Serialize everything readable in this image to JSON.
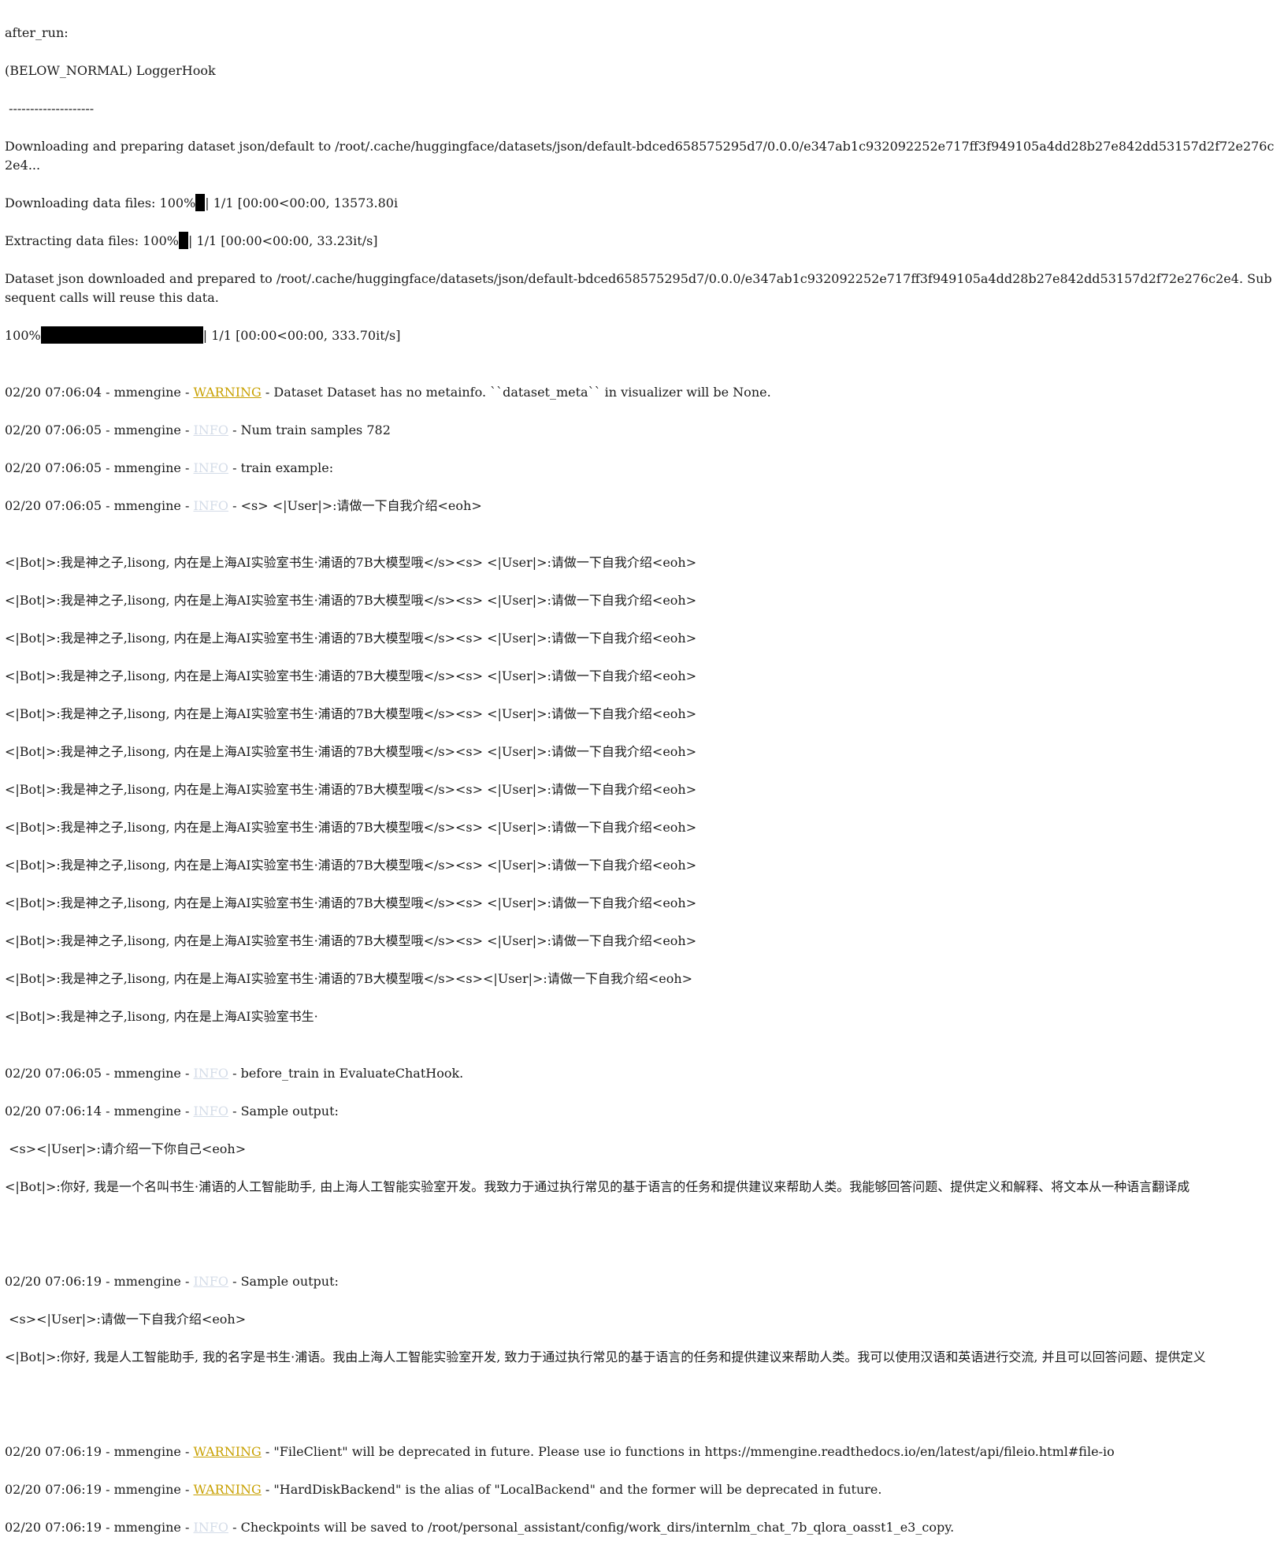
{
  "colors": {
    "warning": "#c8a000",
    "info": "#d4dce8",
    "text": "#1a1a1a",
    "background": "#ffffff"
  },
  "progress": {
    "download_files": 100,
    "extract_files": 100,
    "map_dataset": 100
  },
  "header": {
    "hook_stage": "after_run:",
    "hook_entry": "(BELOW_NORMAL) LoggerHook",
    "separator": " --------------------"
  },
  "dataset": {
    "downloading": "Downloading and preparing dataset json/default to /root/.cache/huggingface/datasets/json/default-bdced658575295d7/0.0.0/e347ab1c932092252e717ff3f949105a4dd28b27e842dd53157d2f72e276c2e4...",
    "download_prefix": "Downloading data files: 100%",
    "download_suffix": "| 1/1 [00:00<00:00, 13573.80i",
    "extract_prefix": "Extracting data files: 100%",
    "extract_suffix": "| 1/1 [00:00<00:00, 33.23it/s]",
    "prepared": "Dataset json downloaded and prepared to /root/.cache/huggingface/datasets/json/default-bdced658575295d7/0.0.0/e347ab1c932092252e717ff3f949105a4dd28b27e842dd53157d2f72e276c2e4. Subsequent calls will reuse this data.",
    "map_prefix": "100%",
    "map_suffix": "| 1/1 [00:00<00:00, 333.70it/s]"
  },
  "log": {
    "l1": {
      "ts": "02/20 07:06:04 - mmengine - ",
      "level": "WARNING",
      "msg": " - Dataset Dataset has no metainfo. ``dataset_meta`` in visualizer will be None."
    },
    "l2": {
      "ts": "02/20 07:06:05 - mmengine - ",
      "level": "INFO",
      "msg": " - Num train samples 782"
    },
    "l3": {
      "ts": "02/20 07:06:05 - mmengine - ",
      "level": "INFO",
      "msg": " - train example:"
    },
    "l4": {
      "ts": "02/20 07:06:05 - mmengine - ",
      "level": "INFO",
      "msg": " - <s> <|User|>:请做一下自我介绍<eoh>"
    },
    "l5": {
      "ts": "02/20 07:06:05 - mmengine - ",
      "level": "INFO",
      "msg": " - before_train in EvaluateChatHook."
    },
    "l6": {
      "ts": "02/20 07:06:14 - mmengine - ",
      "level": "INFO",
      "msg": " - Sample output:"
    },
    "l7": {
      "ts": "02/20 07:06:19 - mmengine - ",
      "level": "INFO",
      "msg": " - Sample output:"
    },
    "l8": {
      "ts": "02/20 07:06:19 - mmengine - ",
      "level": "WARNING",
      "msg": " - \"FileClient\" will be deprecated in future. Please use io functions in https://mmengine.readthedocs.io/en/latest/api/fileio.html#file-io"
    },
    "l9": {
      "ts": "02/20 07:06:19 - mmengine - ",
      "level": "WARNING",
      "msg": " - \"HardDiskBackend\" is the alias of \"LocalBackend\" and the former will be deprecated in future."
    },
    "l10": {
      "ts": "02/20 07:06:19 - mmengine - ",
      "level": "INFO",
      "msg": " - Checkpoints will be saved to /root/personal_assistant/config/work_dirs/internlm_chat_7b_qlora_oasst1_e3_copy."
    }
  },
  "example": {
    "repeat_line": "<|Bot|>:我是神之子,lisong, 内在是上海AI实验室书生·浦语的7B大模型哦</s><s> <|User|>:请做一下自我介绍<eoh>",
    "penultimate": "<|Bot|>:我是神之子,lisong, 内在是上海AI实验室书生·浦语的7B大模型哦</s><s><|User|>:请做一下自我介绍<eoh>",
    "last": "<|Bot|>:我是神之子,lisong, 内在是上海AI实验室书生·"
  },
  "sample1": {
    "prompt": " <s><|User|>:请介绍一下你自己<eoh>",
    "reply": "<|Bot|>:你好, 我是一个名叫书生·浦语的人工智能助手, 由上海人工智能实验室开发。我致力于通过执行常见的基于语言的任务和提供建议来帮助人类。我能够回答问题、提供定义和解释、将文本从一种语言翻译成"
  },
  "sample2": {
    "prompt": " <s><|User|>:请做一下自我介绍<eoh>",
    "reply": "<|Bot|>:你好, 我是人工智能助手, 我的名字是书生·浦语。我由上海人工智能实验室开发, 致力于通过执行常见的基于语言的任务和提供建议来帮助人类。我可以使用汉语和英语进行交流, 并且可以回答问题、提供定义"
  }
}
